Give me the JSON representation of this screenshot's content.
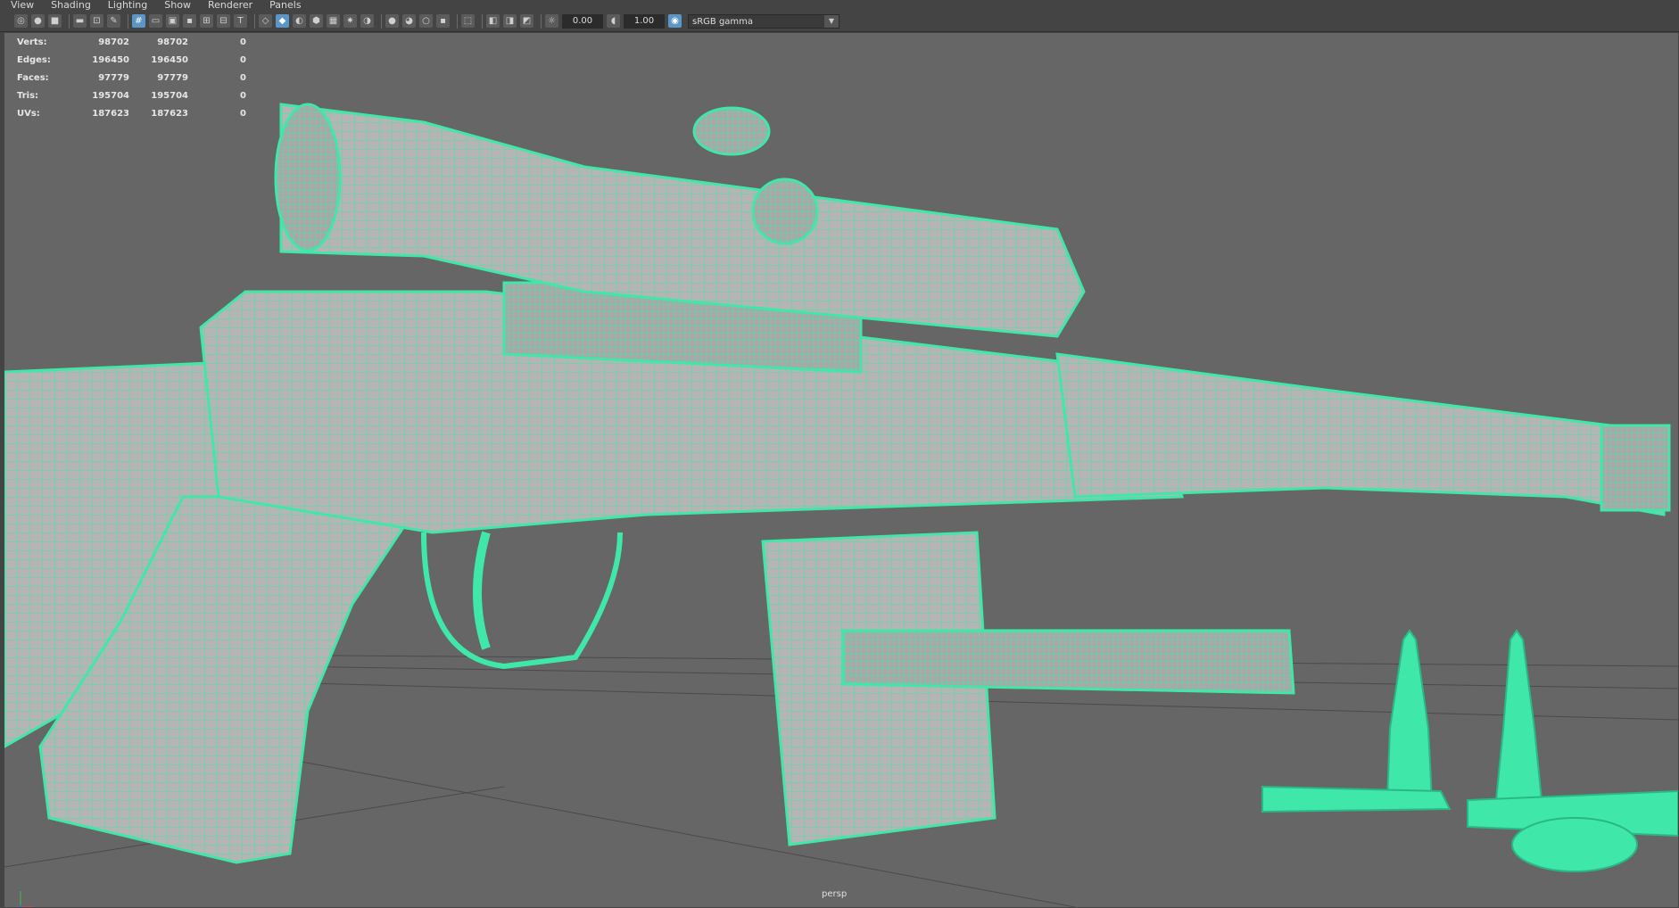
{
  "menu": [
    "View",
    "Shading",
    "Lighting",
    "Show",
    "Renderer",
    "Panels"
  ],
  "toolbar": {
    "exposure": "0.00",
    "gamma": "1.00",
    "color_space": "sRGB gamma",
    "icons": [
      "select-camera-icon",
      "lock-camera-icon",
      "bookmark-icon",
      "image-plane-icon",
      "2d-pan-zoom-icon",
      "grease-pencil-icon",
      "grid-icon",
      "film-gate-icon",
      "resolution-gate-icon",
      "gate-mask-icon",
      "field-chart-icon",
      "safe-action-icon",
      "safe-title-icon",
      "wireframe-icon",
      "smooth-shade-icon",
      "use-default-material-icon",
      "wireframe-on-shaded-icon",
      "textured-icon",
      "lights-icon",
      "shadows-icon",
      "ambient-occlusion-icon",
      "motion-blur-icon",
      "anti-aliasing-icon",
      "depth-of-field-icon",
      "isolate-select-icon",
      "xray-icon",
      "xray-joints-icon",
      "backface-icon",
      "exposure-icon",
      "gamma-icon",
      "color-management-icon"
    ]
  },
  "hud": {
    "rows": [
      {
        "label": "Verts:",
        "a": "98702",
        "b": "98702",
        "c": "0"
      },
      {
        "label": "Edges:",
        "a": "196450",
        "b": "196450",
        "c": "0"
      },
      {
        "label": "Faces:",
        "a": "97779",
        "b": "97779",
        "c": "0"
      },
      {
        "label": "Tris:",
        "a": "195704",
        "b": "195704",
        "c": "0"
      },
      {
        "label": "UVs:",
        "a": "187623",
        "b": "187623",
        "c": "0"
      }
    ]
  },
  "camera_label": "persp",
  "colors": {
    "wire": "#3fe8a8",
    "mesh": "#b5b5b5",
    "background": "#666666"
  }
}
